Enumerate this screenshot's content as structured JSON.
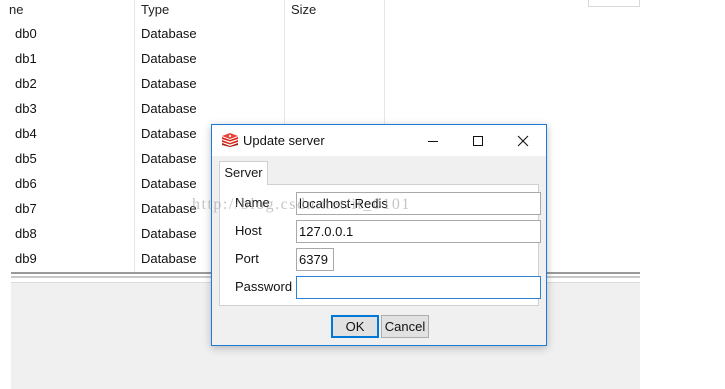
{
  "list": {
    "headers": [
      "ne",
      "Type",
      "Size"
    ],
    "rows": [
      {
        "name": "db0",
        "type": "Database"
      },
      {
        "name": "db1",
        "type": "Database"
      },
      {
        "name": "db2",
        "type": "Database"
      },
      {
        "name": "db3",
        "type": "Database"
      },
      {
        "name": "db4",
        "type": "Database"
      },
      {
        "name": "db5",
        "type": "Database"
      },
      {
        "name": "db6",
        "type": "Database"
      },
      {
        "name": "db7",
        "type": "Database"
      },
      {
        "name": "db8",
        "type": "Database"
      },
      {
        "name": "db9",
        "type": "Database"
      }
    ]
  },
  "dialog": {
    "title": "Update server",
    "icon": "redis-icon",
    "tab_label": "Server",
    "fields": {
      "name": {
        "label": "Name",
        "value": "localhost-Redis"
      },
      "host": {
        "label": "Host",
        "value": "127.0.0.1"
      },
      "port": {
        "label": "Port",
        "value": "6379"
      },
      "password": {
        "label": "Password",
        "value": ""
      }
    },
    "ok_label": "OK",
    "cancel_label": "Cancel"
  },
  "watermark": "http://blog.csdn.net/it_0101",
  "colors": {
    "accent": "#1e7ad4",
    "focus_border": "#2e82d1",
    "panel": "#f0f0f0",
    "redis_red": "#d82c20"
  }
}
